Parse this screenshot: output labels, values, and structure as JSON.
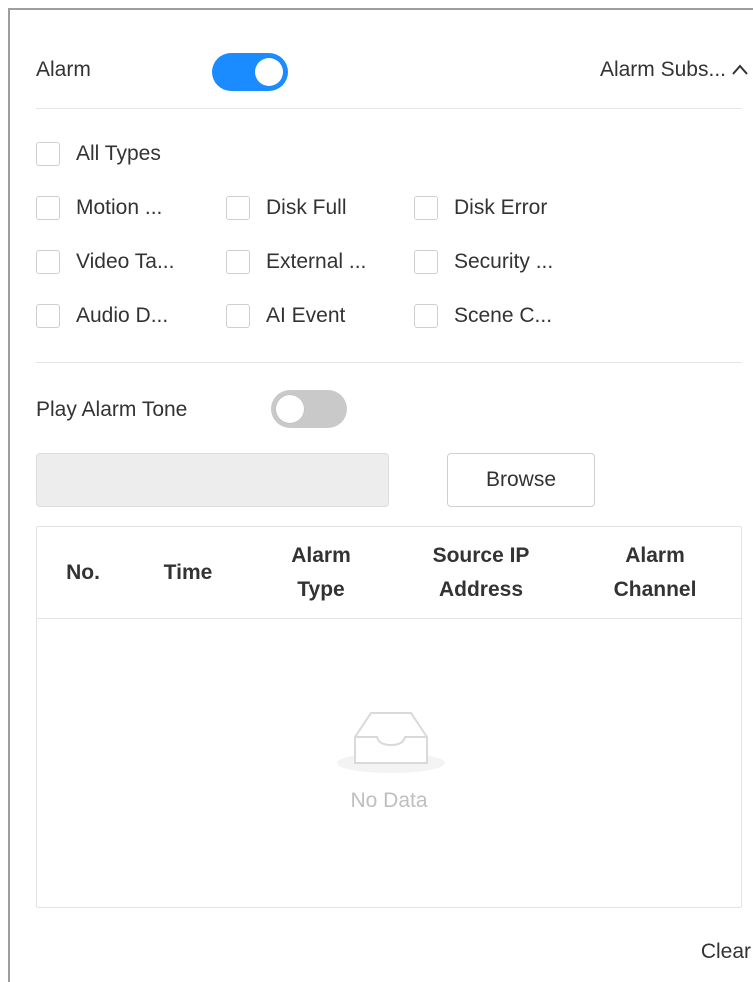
{
  "header": {
    "alarm_label": "Alarm",
    "alarm_enabled": true,
    "subscription_label": "Alarm Subs...",
    "subscription_icon": "chevron-up-icon"
  },
  "alarm_types": {
    "all": "All Types",
    "rows": [
      [
        "Motion ...",
        "Disk Full",
        "Disk Error"
      ],
      [
        "Video Ta...",
        "External ...",
        "Security ..."
      ],
      [
        "Audio D...",
        "AI Event",
        "Scene C..."
      ]
    ]
  },
  "tone": {
    "label": "Play Alarm Tone",
    "enabled": false,
    "file_value": "",
    "browse_label": "Browse"
  },
  "table": {
    "columns": [
      [
        "No."
      ],
      [
        "Time"
      ],
      [
        "Alarm",
        "Type"
      ],
      [
        "Source IP",
        "Address"
      ],
      [
        "Alarm",
        "Channel"
      ]
    ],
    "rows": [],
    "empty_text": "No Data",
    "empty_icon": "empty-inbox-icon"
  },
  "footer": {
    "clear_label": "Clear"
  },
  "colors": {
    "accent": "#1a8cff",
    "toggle_off": "#c9c9c9",
    "muted_text": "#bfbfbf"
  }
}
